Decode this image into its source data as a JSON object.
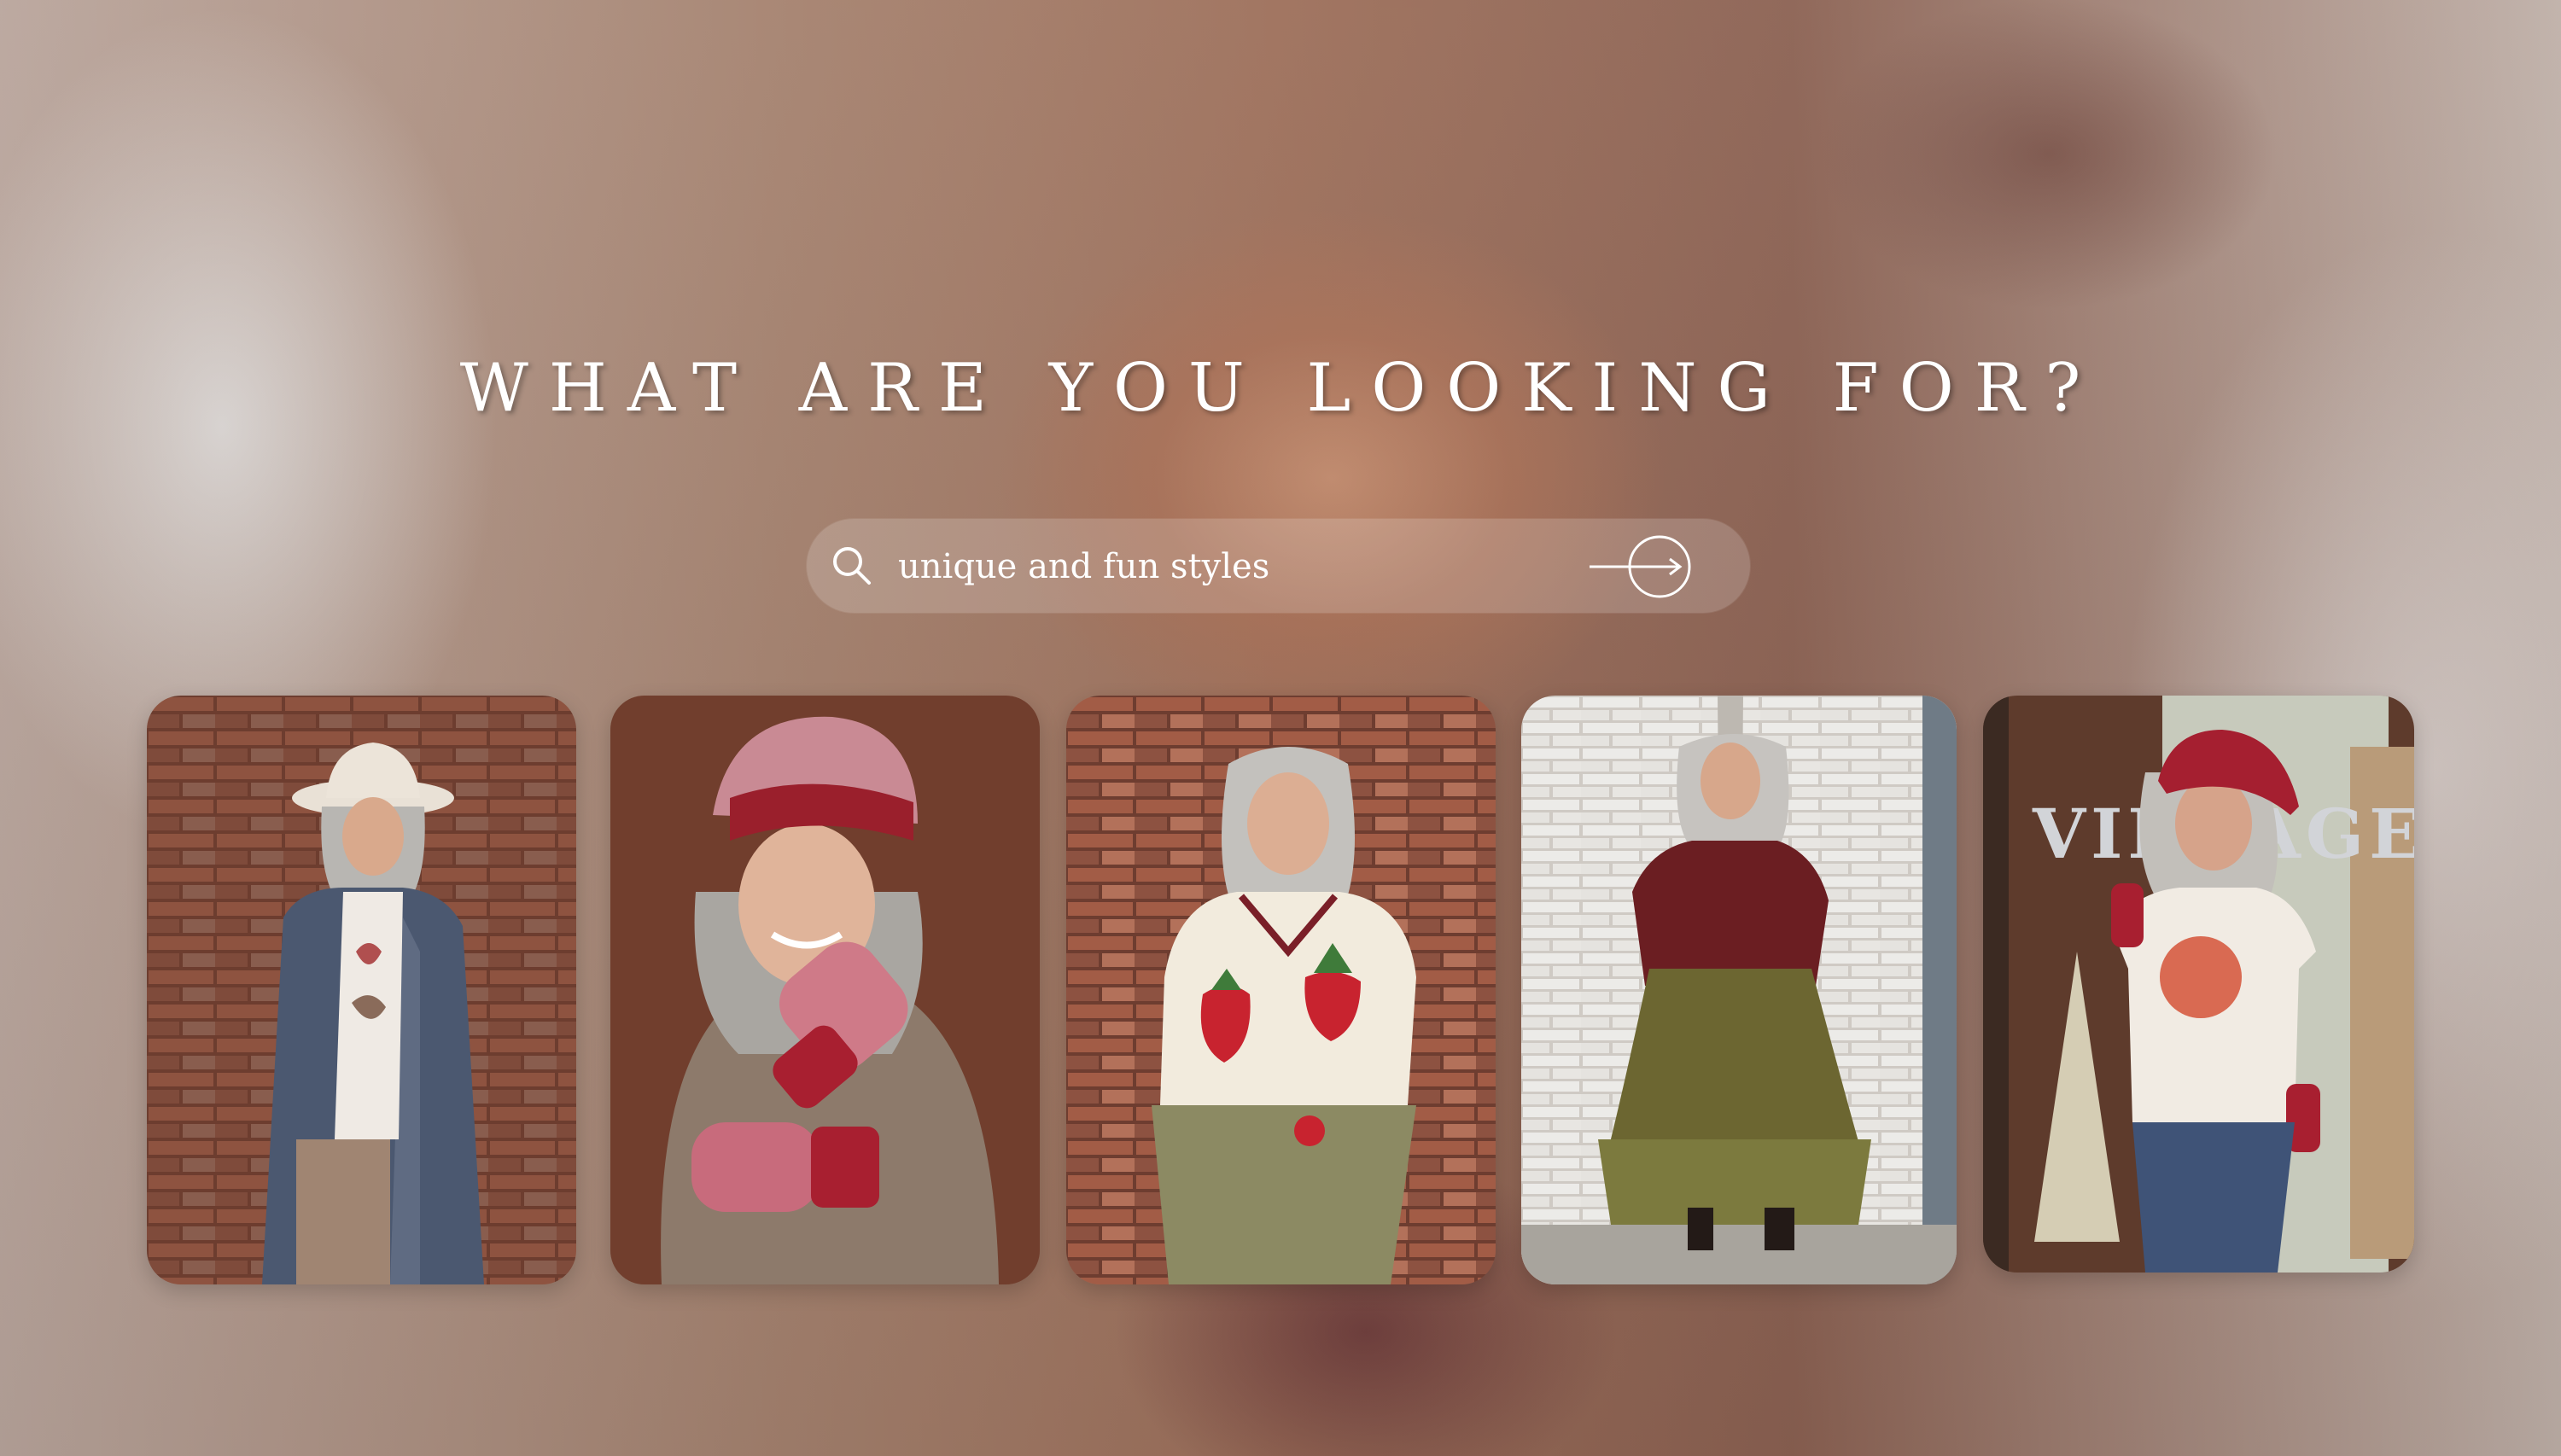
{
  "hero": {
    "headline": "WHAT ARE YOU LOOKING FOR?"
  },
  "search": {
    "value": "unique and fun styles",
    "search_icon": "search-icon",
    "submit_icon": "arrow-right-circle-icon"
  },
  "gallery": {
    "cards": [
      {
        "name": "look-hat-denim-coat",
        "sign_text": ""
      },
      {
        "name": "look-knit-beanie-mittens",
        "sign_text": ""
      },
      {
        "name": "look-strawberry-cardigan",
        "sign_text": ""
      },
      {
        "name": "look-burgundy-jacket-skirt",
        "sign_text": ""
      },
      {
        "name": "look-vintage-store-tee",
        "sign_text": "VINTAGE"
      }
    ]
  },
  "colors": {
    "text": "#ffffff",
    "brick": "#9a5a44",
    "burgundy": "#8e1f2c"
  }
}
